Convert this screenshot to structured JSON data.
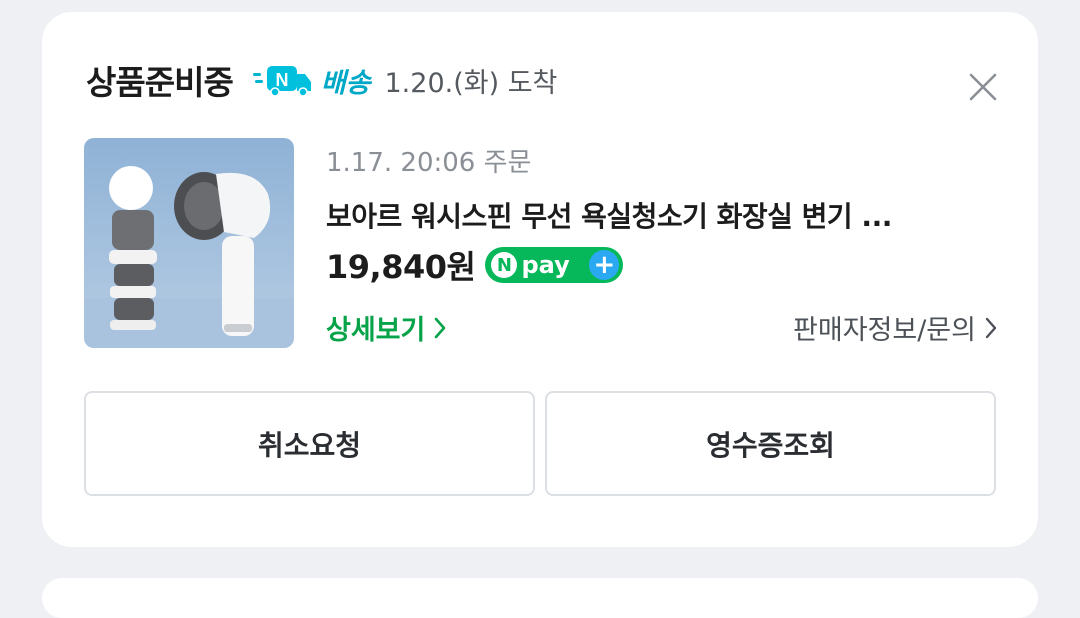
{
  "order": {
    "status": "상품준비중",
    "delivery_label": "배송",
    "delivery_date": "1.20.(화) 도착",
    "order_date": "1.17. 20:06 주문",
    "product_name": "보아르 워시스핀 무선 욕실청소기 화장실 변기 ...",
    "price": "19,840원",
    "npay_badge": "pay",
    "detail_link": "상세보기",
    "seller_link": "판매자정보/문의",
    "cancel_button": "취소요청",
    "receipt_button": "영수증조회"
  },
  "icons": {
    "delivery": "n-delivery-truck-icon",
    "close": "close-icon",
    "chevron": "chevron-right-icon",
    "npay_plus": "plus-icon"
  },
  "colors": {
    "green": "#07a349",
    "npay_green": "#07b85a",
    "delivery_cyan": "#00a8c8"
  }
}
